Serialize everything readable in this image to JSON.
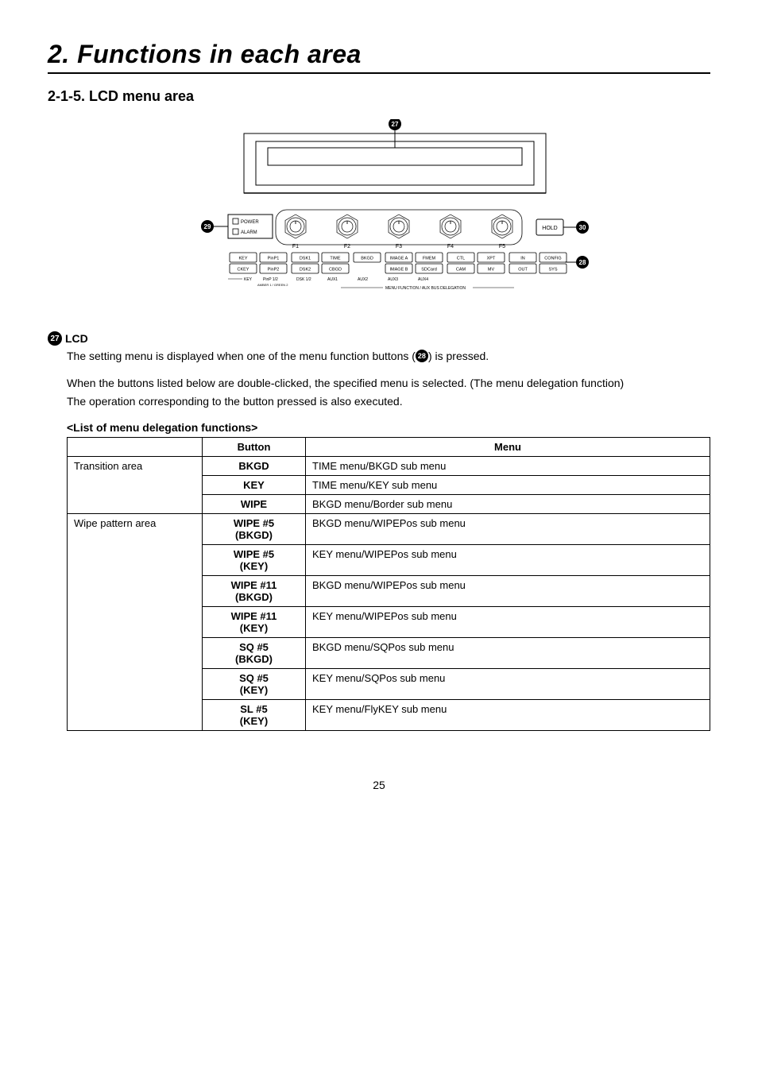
{
  "chapter_title": "2. Functions in each area",
  "section_title": "2-1-5. LCD menu area",
  "diagram": {
    "callout27": "27",
    "callout28": "28",
    "callout29": "29",
    "callout30": "30",
    "power_label": "POWER",
    "alarm_label": "ALARM",
    "hold_label": "HOLD",
    "knobs": [
      "F1",
      "F2",
      "F3",
      "F4",
      "F5"
    ],
    "row_top": [
      "KEY",
      "PinP1",
      "DSK1",
      "TIME",
      "BKGD",
      "IMAGE A",
      "FMEM",
      "CTL",
      "XPT",
      "IN",
      "CONFIG"
    ],
    "row_bot": [
      "CKEY",
      "PinP2",
      "DSK2",
      "CBGD",
      "",
      "IMAGE B",
      "SDCard",
      "CAM",
      "MV",
      "OUT",
      "SYS"
    ],
    "sub_labels": {
      "key": "KEY",
      "pinp": "PinP 1/2",
      "pinp_sub": "AMBER 1 / GREEN 2",
      "dsk": "DSK 1/2",
      "aux1": "AUX1",
      "aux2": "AUX2",
      "aux3": "AUX3",
      "aux4": "AUX4"
    },
    "bus_label": "MENU FUNCTION / AUX BUS DELEGATION"
  },
  "item": {
    "num": "27",
    "name": "LCD",
    "p1_a": "The setting menu is displayed when one of the menu function buttons (",
    "p1_ref": "28",
    "p1_b": ") is pressed.",
    "p2": "When the buttons listed below are double-clicked, the specified menu is selected. (The menu delegation function)",
    "p3": "The operation corresponding to the button pressed is also executed."
  },
  "table": {
    "heading": "<List of menu delegation functions>",
    "col_button": "Button",
    "col_menu": "Menu",
    "groups": [
      {
        "category": "Transition area",
        "rows": [
          {
            "button": "BKGD",
            "menu": "TIME menu/BKGD sub menu"
          },
          {
            "button": "KEY",
            "menu": "TIME menu/KEY sub menu"
          },
          {
            "button": "WIPE",
            "menu": "BKGD menu/Border sub menu"
          }
        ]
      },
      {
        "category": "Wipe pattern area",
        "rows": [
          {
            "button": "WIPE #5\n(BKGD)",
            "menu": "BKGD menu/WIPEPos sub menu"
          },
          {
            "button": "WIPE #5\n(KEY)",
            "menu": "KEY menu/WIPEPos sub menu"
          },
          {
            "button": "WIPE #11\n(BKGD)",
            "menu": "BKGD menu/WIPEPos sub menu"
          },
          {
            "button": "WIPE #11\n(KEY)",
            "menu": "KEY menu/WIPEPos sub menu"
          },
          {
            "button": "SQ #5\n(BKGD)",
            "menu": "BKGD menu/SQPos sub menu"
          },
          {
            "button": "SQ #5\n(KEY)",
            "menu": "KEY menu/SQPos sub menu"
          },
          {
            "button": "SL #5\n(KEY)",
            "menu": "KEY menu/FlyKEY sub menu"
          }
        ]
      }
    ]
  },
  "page_number": "25"
}
